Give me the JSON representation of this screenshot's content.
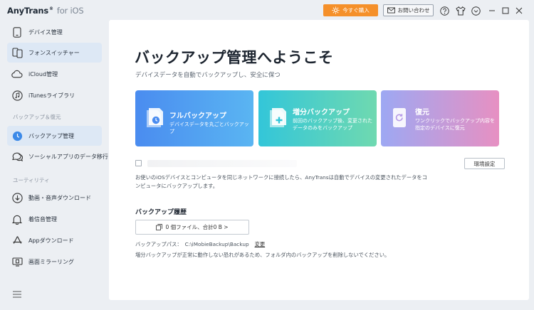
{
  "app": {
    "name": "AnyTrans",
    "reg_mark": "®",
    "platform": "for iOS"
  },
  "titlebar": {
    "buy_label": "今すぐ購入",
    "contact_label": "お問い合わせ",
    "icons": [
      "help-icon",
      "tshirt-icon",
      "chevron-down-icon",
      "minimize-icon",
      "maximize-icon",
      "close-icon"
    ]
  },
  "sidebar": {
    "items": [
      {
        "label": "デバイス管理",
        "icon": "device-icon"
      },
      {
        "label": "フォンスイッチャー",
        "icon": "phone-switch-icon"
      },
      {
        "label": "iCloud管理",
        "icon": "cloud-icon"
      },
      {
        "label": "iTunesライブラリ",
        "icon": "music-icon"
      }
    ],
    "section_backup": "バックアップ＆復元",
    "backup_items": [
      {
        "label": "バックアップ管理",
        "icon": "clock-backup-icon"
      },
      {
        "label": "ソーシャルアプリのデータ移行",
        "icon": "chat-icon"
      }
    ],
    "section_utility": "ユーティリティ",
    "utility_items": [
      {
        "label": "動画・音声ダウンロード",
        "icon": "download-icon"
      },
      {
        "label": "着信音管理",
        "icon": "bell-icon"
      },
      {
        "label": "Appダウンロード",
        "icon": "app-store-icon"
      },
      {
        "label": "画面ミラーリング",
        "icon": "screen-mirror-icon"
      }
    ]
  },
  "main": {
    "title": "バックアップ管理へようこそ",
    "subtitle": "デバイスデータを自動でバックアップし、安全に保つ",
    "cards": [
      {
        "title": "フルバックアップ",
        "desc": "デバイスデータを丸ごとバックアップ"
      },
      {
        "title": "増分バックアップ",
        "desc": "前回のバックアップ後、変更されたデータのみをバックアップ"
      },
      {
        "title": "復元",
        "desc": "ワンクリックでバックアップ内容を指定のデバイスに復元"
      }
    ],
    "settings_label": "環境設定",
    "description": "お使いのiOSデバイスとコンピュータを同じネットワークに接続したら、AnyTransは自動でデバイスの変更されたデータをコンピュータにバックアップします。",
    "history_title": "バックアップ履歴",
    "history_button": "0 個ファイル、合計0 B >",
    "path_label": "バックアップパス：",
    "path_value": "C:\\iMobieBackup\\Backup",
    "path_change": "変更",
    "warning": "増分バックアップが正常に動作しない恐れがあるため、フォルダ内のバックアップを削除しないでください。"
  },
  "colors": {
    "buy": "#f5902a",
    "active_nav": "#dde8f5",
    "card_full": "#4a8cf0",
    "card_incremental": "#33c6d9",
    "card_restore": "#c79ce0"
  }
}
